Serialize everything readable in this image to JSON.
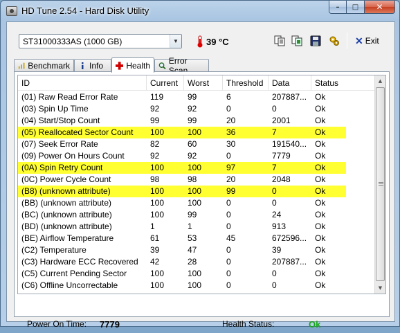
{
  "window": {
    "title": "HD Tune 2.54 - Hard Disk Utility"
  },
  "caption": {
    "minimize": "–",
    "maximize": "□",
    "close": "✕"
  },
  "toolbar": {
    "drive": "ST31000333AS (1000 GB)",
    "temperature": "39 °C",
    "icons": [
      "copy-text-icon",
      "copy-screenshot-icon",
      "save-icon",
      "options-icon"
    ],
    "exit_label": "Exit"
  },
  "tabs": [
    {
      "label": "Benchmark",
      "icon": "benchmark-icon"
    },
    {
      "label": "Info",
      "icon": "info-icon"
    },
    {
      "label": "Health",
      "icon": "health-cross-icon",
      "active": true
    },
    {
      "label": "Error Scan",
      "icon": "magnifier-icon"
    }
  ],
  "table": {
    "columns": [
      "ID",
      "Current",
      "Worst",
      "Threshold",
      "Data",
      "Status"
    ],
    "rows": [
      {
        "id": "(01) Raw Read Error Rate",
        "current": "119",
        "worst": "99",
        "threshold": "6",
        "data": "207887...",
        "status": "Ok",
        "highlight": false
      },
      {
        "id": "(03) Spin Up Time",
        "current": "92",
        "worst": "92",
        "threshold": "0",
        "data": "0",
        "status": "Ok",
        "highlight": false
      },
      {
        "id": "(04) Start/Stop Count",
        "current": "99",
        "worst": "99",
        "threshold": "20",
        "data": "2001",
        "status": "Ok",
        "highlight": false
      },
      {
        "id": "(05) Reallocated Sector Count",
        "current": "100",
        "worst": "100",
        "threshold": "36",
        "data": "7",
        "status": "Ok",
        "highlight": true
      },
      {
        "id": "(07) Seek Error Rate",
        "current": "82",
        "worst": "60",
        "threshold": "30",
        "data": "191540...",
        "status": "Ok",
        "highlight": false
      },
      {
        "id": "(09) Power On Hours Count",
        "current": "92",
        "worst": "92",
        "threshold": "0",
        "data": "7779",
        "status": "Ok",
        "highlight": false
      },
      {
        "id": "(0A) Spin Retry Count",
        "current": "100",
        "worst": "100",
        "threshold": "97",
        "data": "7",
        "status": "Ok",
        "highlight": true
      },
      {
        "id": "(0C) Power Cycle Count",
        "current": "98",
        "worst": "98",
        "threshold": "20",
        "data": "2048",
        "status": "Ok",
        "highlight": false
      },
      {
        "id": "(B8) (unknown attribute)",
        "current": "100",
        "worst": "100",
        "threshold": "99",
        "data": "0",
        "status": "Ok",
        "highlight": true
      },
      {
        "id": "(BB) (unknown attribute)",
        "current": "100",
        "worst": "100",
        "threshold": "0",
        "data": "0",
        "status": "Ok",
        "highlight": false
      },
      {
        "id": "(BC) (unknown attribute)",
        "current": "100",
        "worst": "99",
        "threshold": "0",
        "data": "24",
        "status": "Ok",
        "highlight": false
      },
      {
        "id": "(BD) (unknown attribute)",
        "current": "1",
        "worst": "1",
        "threshold": "0",
        "data": "913",
        "status": "Ok",
        "highlight": false
      },
      {
        "id": "(BE) Airflow Temperature",
        "current": "61",
        "worst": "53",
        "threshold": "45",
        "data": "672596...",
        "status": "Ok",
        "highlight": false
      },
      {
        "id": "(C2) Temperature",
        "current": "39",
        "worst": "47",
        "threshold": "0",
        "data": "39",
        "status": "Ok",
        "highlight": false
      },
      {
        "id": "(C3) Hardware ECC Recovered",
        "current": "42",
        "worst": "28",
        "threshold": "0",
        "data": "207887...",
        "status": "Ok",
        "highlight": false
      },
      {
        "id": "(C5) Current Pending Sector",
        "current": "100",
        "worst": "100",
        "threshold": "0",
        "data": "0",
        "status": "Ok",
        "highlight": false
      },
      {
        "id": "(C6) Offline Uncorrectable",
        "current": "100",
        "worst": "100",
        "threshold": "0",
        "data": "0",
        "status": "Ok",
        "highlight": false
      }
    ]
  },
  "footer": {
    "power_on_label": "Power On Time:",
    "power_on_value": "7779",
    "health_label": "Health Status:",
    "health_value": "Ok"
  },
  "colors": {
    "highlight": "#ffff32",
    "ok_green": "#1aa81a",
    "exit_blue": "#1a3ea8"
  }
}
